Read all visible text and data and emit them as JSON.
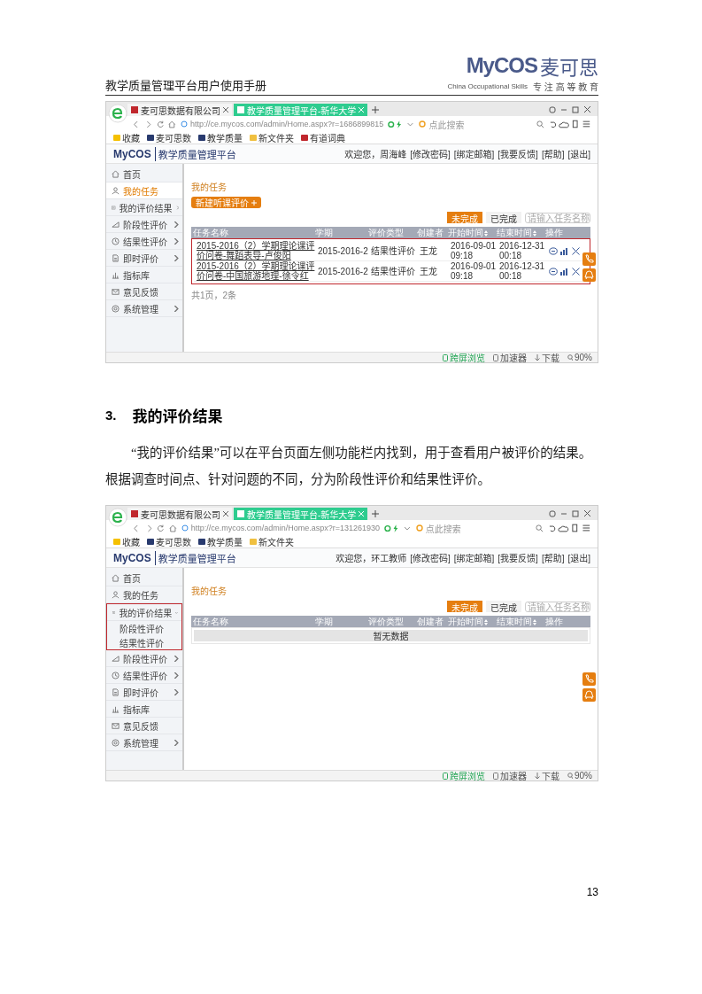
{
  "header": {
    "title": "教学质量管理平台用户使用手册",
    "logo": "MyCOS",
    "logo_cn": "麦可思",
    "tagline_en": "China Occupational Skills",
    "tagline_cn": "专 注 高 等 教 育"
  },
  "blocks": [
    {
      "kind": "screenshot",
      "tabs": [
        {
          "label": "麦可思数据有限公司",
          "selected": false
        },
        {
          "label": "教学质量管理平台-新华大学",
          "selected": true
        }
      ],
      "url": "http://ce.mycos.com/admin/Home.aspx?r=1686899815",
      "search_placeholder": "点此搜索",
      "bookmarks": [
        "收藏",
        "麦可思数",
        "教学质量",
        "新文件夹",
        "有道词典"
      ],
      "logo": "MyCOS",
      "app_title": "教学质量管理平台",
      "welcome": "欢迎您，周海峰",
      "user_links": [
        "[修改密码]",
        "[绑定邮箱]",
        "[我要反馈]",
        "[帮助]",
        "[退出]"
      ],
      "sidebar": [
        {
          "label": "首页",
          "selected": false
        },
        {
          "label": "我的任务",
          "selected": true
        },
        {
          "label": "我的评价结果",
          "selected": false,
          "expanded": false,
          "highlighted": false
        },
        {
          "label": "阶段性评价",
          "selected": false,
          "expanded": false
        },
        {
          "label": "结果性评价",
          "selected": false,
          "expanded": false
        },
        {
          "label": "即时评价",
          "selected": false,
          "expanded": false
        },
        {
          "label": "指标库",
          "selected": false
        },
        {
          "label": "意见反馈",
          "selected": false
        },
        {
          "label": "系统管理",
          "selected": false,
          "expanded": false
        }
      ],
      "content": {
        "title": "我的任务",
        "new_button": "新建听课评价",
        "filters": [
          {
            "label": "未完成",
            "selected": true
          },
          {
            "label": "已完成",
            "selected": false
          }
        ],
        "search_placeholder": "请输入任务名称",
        "columns": [
          "任务名称",
          "学期",
          "评价类型",
          "创建者",
          "开始时间",
          "结束时间",
          "操作"
        ],
        "highlighted": true,
        "rows": [
          {
            "name": "2015-2016（2）学期理论课评价问卷-舞蹈表导-卢俊阳",
            "term": "2015-2016-2",
            "type": "结果性评价",
            "creator": "王龙",
            "start": "2016-09-01 09:18",
            "end": "2016-12-31 00:18"
          },
          {
            "name": "2015-2016（2）学期理论课评价问卷-中国旅游地理-徐令红",
            "term": "2015-2016-2",
            "type": "结果性评价",
            "creator": "王龙",
            "start": "2016-09-01 09:18",
            "end": "2016-12-31 00:18"
          }
        ],
        "footer": "共1页，2条"
      },
      "status_bar": [
        "跨屏浏览",
        "加速器",
        "下载",
        "90%"
      ]
    },
    {
      "kind": "heading",
      "number": "3.",
      "text": "我的评价结果"
    },
    {
      "kind": "paragraph",
      "text": "“我的评价结果”可以在平台页面左侧功能栏内找到，用于查看用户被评价的结果。根据调查时间点、针对问题的不同，分为阶段性评价和结果性评价。"
    },
    {
      "kind": "screenshot",
      "tabs": [
        {
          "label": "麦可思数据有限公司",
          "selected": false
        },
        {
          "label": "教学质量管理平台-新华大学",
          "selected": true
        }
      ],
      "url": "http://ce.mycos.com/admin/Home.aspx?r=131261930",
      "search_placeholder": "点此搜索",
      "bookmarks": [
        "收藏",
        "麦可思数",
        "教学质量",
        "新文件夹"
      ],
      "logo": "MyCOS",
      "app_title": "教学质量管理平台",
      "welcome": "欢迎您，环工教师",
      "user_links": [
        "[修改密码]",
        "[绑定邮箱]",
        "[我要反馈]",
        "[帮助]",
        "[退出]"
      ],
      "sidebar": [
        {
          "label": "首页",
          "selected": false
        },
        {
          "label": "我的任务",
          "selected": false
        },
        {
          "label": "我的评价结果",
          "selected": false,
          "expanded": true,
          "highlighted": true,
          "children": [
            "阶段性评价",
            "结果性评价"
          ]
        },
        {
          "label": "阶段性评价",
          "selected": false,
          "expanded": false
        },
        {
          "label": "结果性评价",
          "selected": false,
          "expanded": false
        },
        {
          "label": "即时评价",
          "selected": false,
          "expanded": false
        },
        {
          "label": "指标库",
          "selected": false
        },
        {
          "label": "意见反馈",
          "selected": false
        },
        {
          "label": "系统管理",
          "selected": false,
          "expanded": false
        }
      ],
      "content": {
        "title": "我的任务",
        "filters": [
          {
            "label": "未完成",
            "selected": true
          },
          {
            "label": "已完成",
            "selected": false
          }
        ],
        "search_placeholder": "请输入任务名称",
        "columns": [
          "任务名称",
          "学期",
          "评价类型",
          "创建者",
          "开始时间",
          "结束时间",
          "操作"
        ],
        "highlighted": false,
        "empty_text": "暂无数据"
      },
      "status_bar": [
        "跨屏浏览",
        "加速器",
        "下载",
        "90%"
      ]
    }
  ],
  "page_number": "13"
}
